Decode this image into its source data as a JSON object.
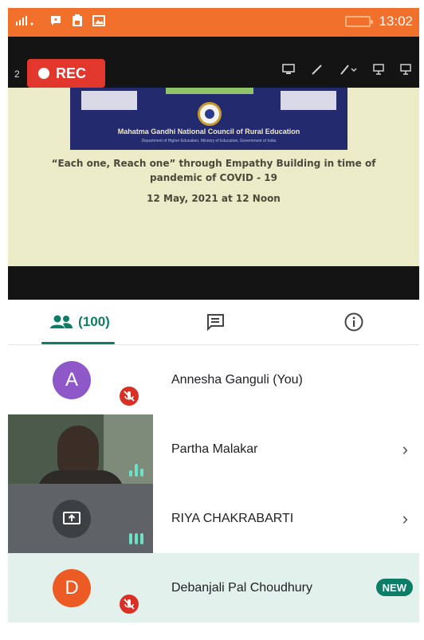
{
  "status_bar": {
    "time": "13:02"
  },
  "recording": {
    "label": "REC",
    "page_indicator": "2"
  },
  "slide": {
    "org": "Mahatma Gandhi National Council of Rural Education",
    "org_sub": "Department of Higher Education, Ministry of Education, Government of India",
    "headline": "“Each one, Reach one” through Empathy Building in time of pandemic of COVID - 19",
    "date": "12 May,  2021  at 12 Noon"
  },
  "tabs": {
    "people_count": "(100)"
  },
  "participants": [
    {
      "avatar_letter": "A",
      "name": "Annesha Ganguli (You)",
      "avatar_color": "#8e58c9"
    },
    {
      "name": "Partha Malakar"
    },
    {
      "name": "RIYA CHAKRABARTI"
    },
    {
      "avatar_letter": "D",
      "name": "Debanjali Pal Choudhury",
      "badge": "NEW",
      "avatar_color": "#ec5b24"
    }
  ],
  "colors": {
    "accent": "#0d7d67",
    "status_bar": "#f0702c",
    "rec": "#e1372c"
  }
}
